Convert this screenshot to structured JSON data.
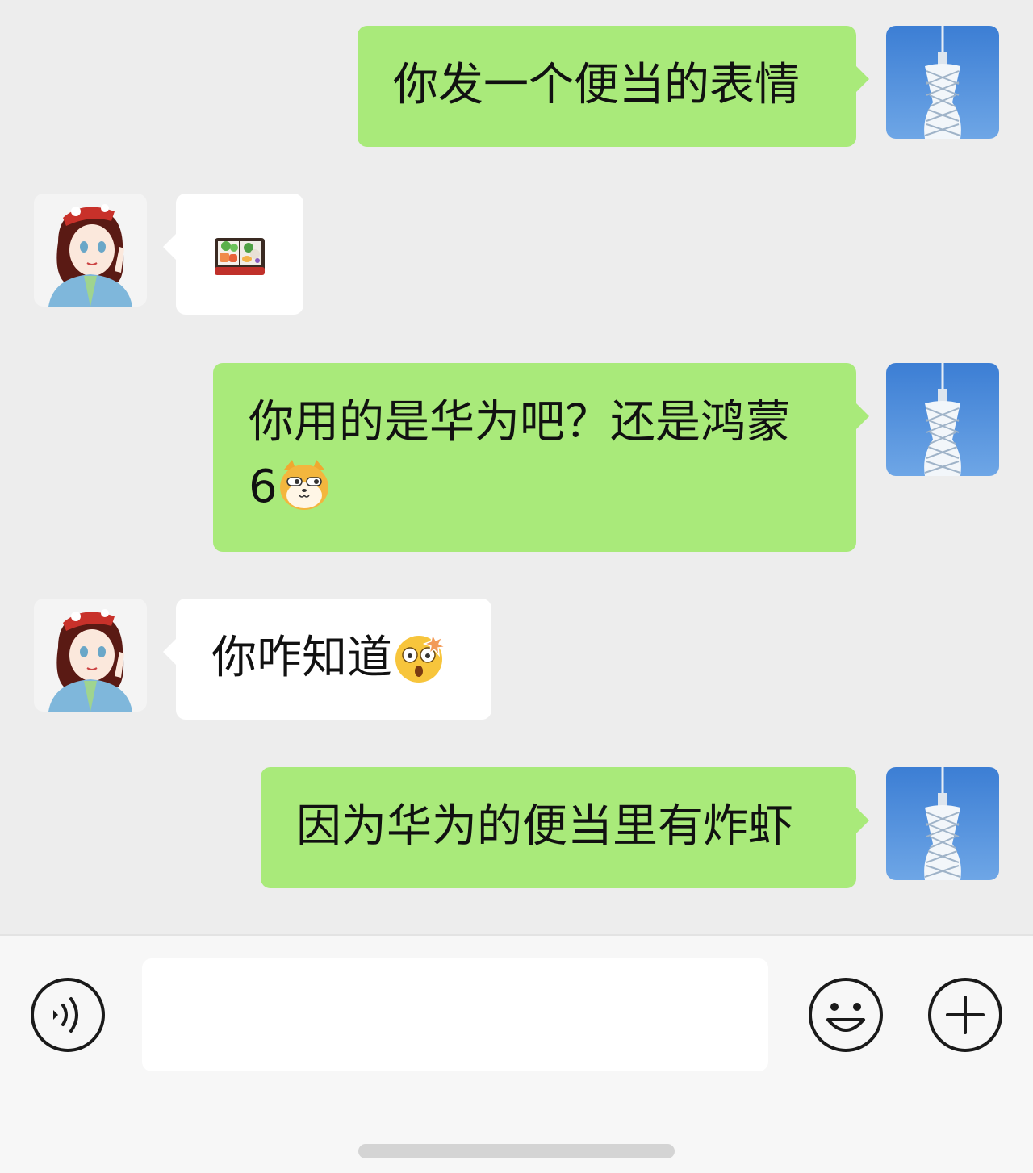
{
  "messages": [
    {
      "sender": "self",
      "text": "你发一个便当的表情",
      "avatar_icon": "canton-tower-avatar-icon"
    },
    {
      "sender": "other",
      "text": "",
      "emoji": "bento-box-emoji",
      "avatar_icon": "anime-girl-avatar-icon"
    },
    {
      "sender": "self",
      "text_line1": "你用的是华为吧？还是鸿蒙",
      "text_line2": "6",
      "emoji": "doge-emoji",
      "avatar_icon": "canton-tower-avatar-icon"
    },
    {
      "sender": "other",
      "text": "你咋知道",
      "emoji": "shocked-face-emoji",
      "avatar_icon": "anime-girl-avatar-icon"
    },
    {
      "sender": "self",
      "text": "因为华为的便当里有炸虾",
      "avatar_icon": "canton-tower-avatar-icon"
    }
  ],
  "input_bar": {
    "value": "",
    "placeholder": "",
    "voice_icon": "voice-icon",
    "emoji_icon": "smiley-face-icon",
    "plus_icon": "plus-circle-icon"
  },
  "colors": {
    "background": "#ededed",
    "self_bubble": "#a9ea7a",
    "other_bubble": "#ffffff",
    "input_bar": "#f7f7f7"
  }
}
